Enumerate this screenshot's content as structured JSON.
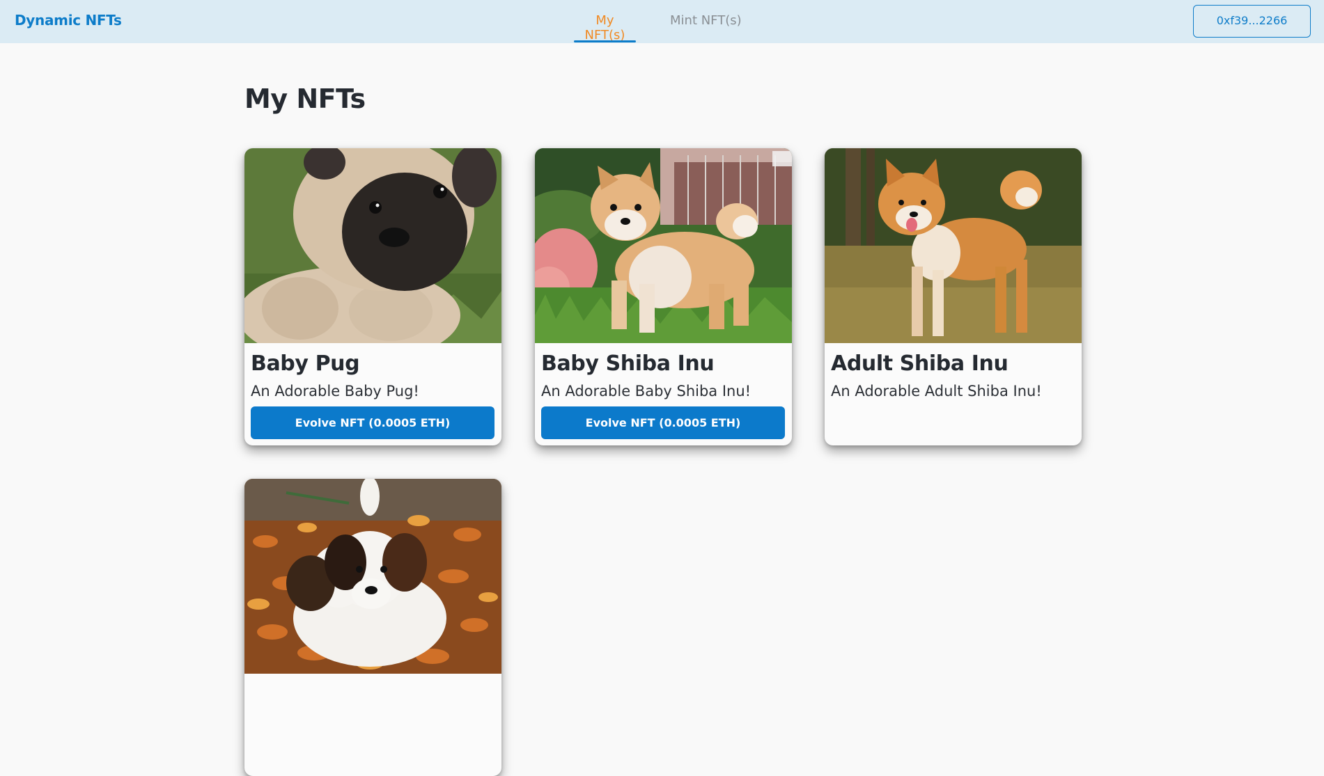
{
  "navbar": {
    "brand": "Dynamic NFTs",
    "tabs": [
      {
        "label": "My NFT(s)",
        "active": true
      },
      {
        "label": "Mint NFT(s)",
        "active": false
      }
    ],
    "wallet_label": "0xf39...2266"
  },
  "colors": {
    "brand": "#0d7cc9",
    "active_tab": "#f08a24",
    "navbar_bg": "#dbebf4",
    "button_bg": "#0c7acb"
  },
  "page": {
    "title": "My NFTs"
  },
  "nfts": [
    {
      "name": "Baby Pug",
      "description": "An Adorable Baby Pug!",
      "button_label": "Evolve NFT (0.0005 ETH)",
      "image": "baby-pug-photo"
    },
    {
      "name": "Baby Shiba Inu",
      "description": "An Adorable Baby Shiba Inu!",
      "button_label": "Evolve NFT (0.0005 ETH)",
      "image": "baby-shiba-photo"
    },
    {
      "name": "Adult Shiba Inu",
      "description": "An Adorable Adult Shiba Inu!",
      "image": "adult-shiba-photo"
    },
    {
      "image": "puppy-in-leaves-photo"
    }
  ]
}
